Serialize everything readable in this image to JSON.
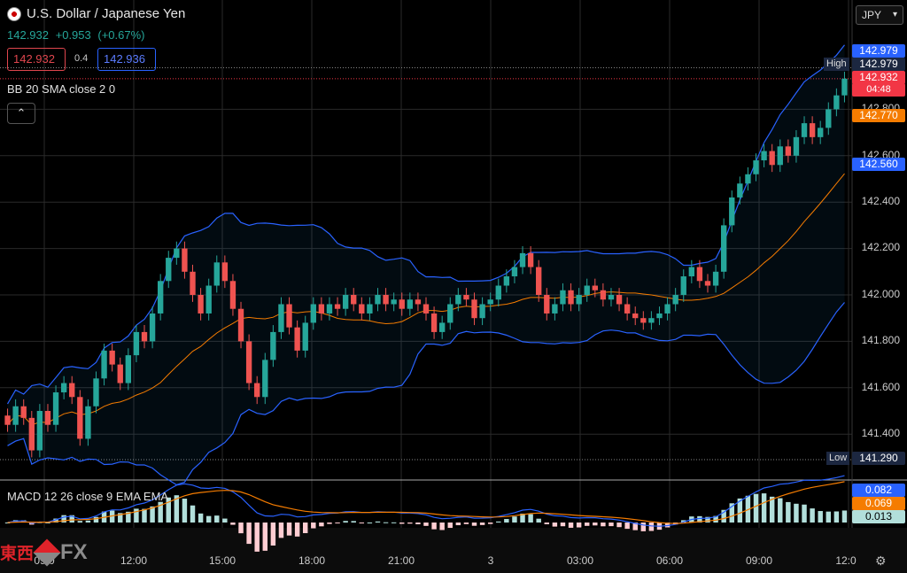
{
  "header": {
    "symbol_name": "U.S. Dollar / Japanese Yen",
    "flag_icon": "us-jp-flag-icon",
    "last_price": "142.932",
    "change": "+0.953",
    "change_pct": "(+0.67%)",
    "sell_price": "142.932",
    "spread": "0.4",
    "buy_price": "142.936",
    "currency": "JPY"
  },
  "indicators": {
    "bb_label": "BB 20 SMA close 2 0",
    "macd_label": "MACD 12 26 close 9 EMA EMA"
  },
  "price_axis": {
    "ticks": [
      "142.800",
      "142.600",
      "142.400",
      "142.200",
      "142.000",
      "141.800",
      "141.600",
      "141.400"
    ],
    "labels": {
      "bb_upper": "142.979",
      "high": "142.979",
      "high_tag": "High",
      "last": "142.932",
      "countdown": "04:48",
      "bb_mid": "142.770",
      "bb_lower": "142.560",
      "low": "141.290",
      "low_tag": "Low"
    },
    "colors": {
      "blue": "#2962ff",
      "red": "#f23645",
      "orange": "#f57c00",
      "dark": "#1c2740"
    }
  },
  "macd_axis": {
    "macd": "0.082",
    "signal": "0.069",
    "hist": "0.013"
  },
  "time_axis": [
    "09:0",
    "12:00",
    "15:00",
    "18:00",
    "21:00",
    "3",
    "03:00",
    "06:00",
    "09:00",
    "12:0"
  ],
  "logo": {
    "cn": "東西",
    "fx": "FX"
  },
  "colors": {
    "up": "#26a69a",
    "down": "#ef5350",
    "bb_band": "#2962ff",
    "bb_basis": "#f57c00",
    "grid": "#2a2a2a"
  },
  "chart_data": {
    "type": "candlestick",
    "ylim": [
      141.29,
      142.979
    ],
    "points": [
      [
        141.48,
        141.44
      ],
      [
        141.44,
        141.52
      ],
      [
        141.52,
        141.47
      ],
      [
        141.47,
        141.33
      ],
      [
        141.33,
        141.5
      ],
      [
        141.5,
        141.44
      ],
      [
        141.44,
        141.58
      ],
      [
        141.58,
        141.62
      ],
      [
        141.62,
        141.56
      ],
      [
        141.56,
        141.38
      ],
      [
        141.38,
        141.52
      ],
      [
        141.52,
        141.64
      ],
      [
        141.64,
        141.76
      ],
      [
        141.76,
        141.7
      ],
      [
        141.7,
        141.62
      ],
      [
        141.62,
        141.74
      ],
      [
        141.74,
        141.84
      ],
      [
        141.84,
        141.8
      ],
      [
        141.8,
        141.92
      ],
      [
        141.92,
        142.06
      ],
      [
        142.06,
        142.16
      ],
      [
        142.16,
        142.2
      ],
      [
        142.2,
        142.1
      ],
      [
        142.1,
        142.0
      ],
      [
        142.0,
        141.92
      ],
      [
        141.92,
        142.04
      ],
      [
        142.04,
        142.14
      ],
      [
        142.14,
        142.06
      ],
      [
        142.06,
        141.94
      ],
      [
        141.94,
        141.8
      ],
      [
        141.8,
        141.62
      ],
      [
        141.62,
        141.56
      ],
      [
        141.56,
        141.72
      ],
      [
        141.72,
        141.84
      ],
      [
        141.84,
        141.96
      ],
      [
        141.96,
        141.86
      ],
      [
        141.86,
        141.76
      ],
      [
        141.76,
        141.88
      ],
      [
        141.88,
        141.96
      ],
      [
        141.96,
        141.92
      ],
      [
        141.92,
        141.96
      ],
      [
        141.96,
        141.94
      ],
      [
        141.94,
        142.0
      ],
      [
        142.0,
        141.96
      ],
      [
        141.96,
        141.92
      ],
      [
        141.92,
        141.96
      ],
      [
        141.96,
        142.0
      ],
      [
        142.0,
        141.96
      ],
      [
        141.96,
        141.98
      ],
      [
        141.98,
        141.94
      ],
      [
        141.94,
        141.98
      ],
      [
        141.98,
        141.96
      ],
      [
        141.96,
        141.92
      ],
      [
        141.92,
        141.84
      ],
      [
        141.84,
        141.88
      ],
      [
        141.88,
        141.96
      ],
      [
        141.96,
        142.0
      ],
      [
        142.0,
        141.98
      ],
      [
        141.98,
        141.9
      ],
      [
        141.9,
        141.96
      ],
      [
        141.96,
        141.98
      ],
      [
        141.98,
        142.04
      ],
      [
        142.04,
        142.08
      ],
      [
        142.08,
        142.12
      ],
      [
        142.12,
        142.18
      ],
      [
        142.18,
        142.12
      ],
      [
        142.12,
        142.0
      ],
      [
        142.0,
        141.92
      ],
      [
        141.92,
        141.96
      ],
      [
        141.96,
        142.02
      ],
      [
        142.02,
        141.96
      ],
      [
        141.96,
        142.0
      ],
      [
        142.0,
        142.04
      ],
      [
        142.04,
        142.02
      ],
      [
        142.02,
        141.98
      ],
      [
        141.98,
        142.0
      ],
      [
        142.0,
        141.96
      ],
      [
        141.96,
        141.92
      ],
      [
        141.92,
        141.9
      ],
      [
        141.9,
        141.88
      ],
      [
        141.88,
        141.9
      ],
      [
        141.9,
        141.92
      ],
      [
        141.92,
        141.96
      ],
      [
        141.96,
        142.0
      ],
      [
        142.0,
        142.08
      ],
      [
        142.08,
        142.12
      ],
      [
        142.12,
        142.06
      ],
      [
        142.06,
        142.04
      ],
      [
        142.04,
        142.1
      ],
      [
        142.1,
        142.3
      ],
      [
        142.3,
        142.42
      ],
      [
        142.42,
        142.48
      ],
      [
        142.48,
        142.52
      ],
      [
        142.52,
        142.58
      ],
      [
        142.58,
        142.62
      ],
      [
        142.62,
        142.56
      ],
      [
        142.56,
        142.64
      ],
      [
        142.64,
        142.6
      ],
      [
        142.6,
        142.68
      ],
      [
        142.68,
        142.74
      ],
      [
        142.74,
        142.68
      ],
      [
        142.68,
        142.72
      ],
      [
        142.72,
        142.8
      ],
      [
        142.8,
        142.86
      ],
      [
        142.86,
        142.932
      ]
    ]
  }
}
